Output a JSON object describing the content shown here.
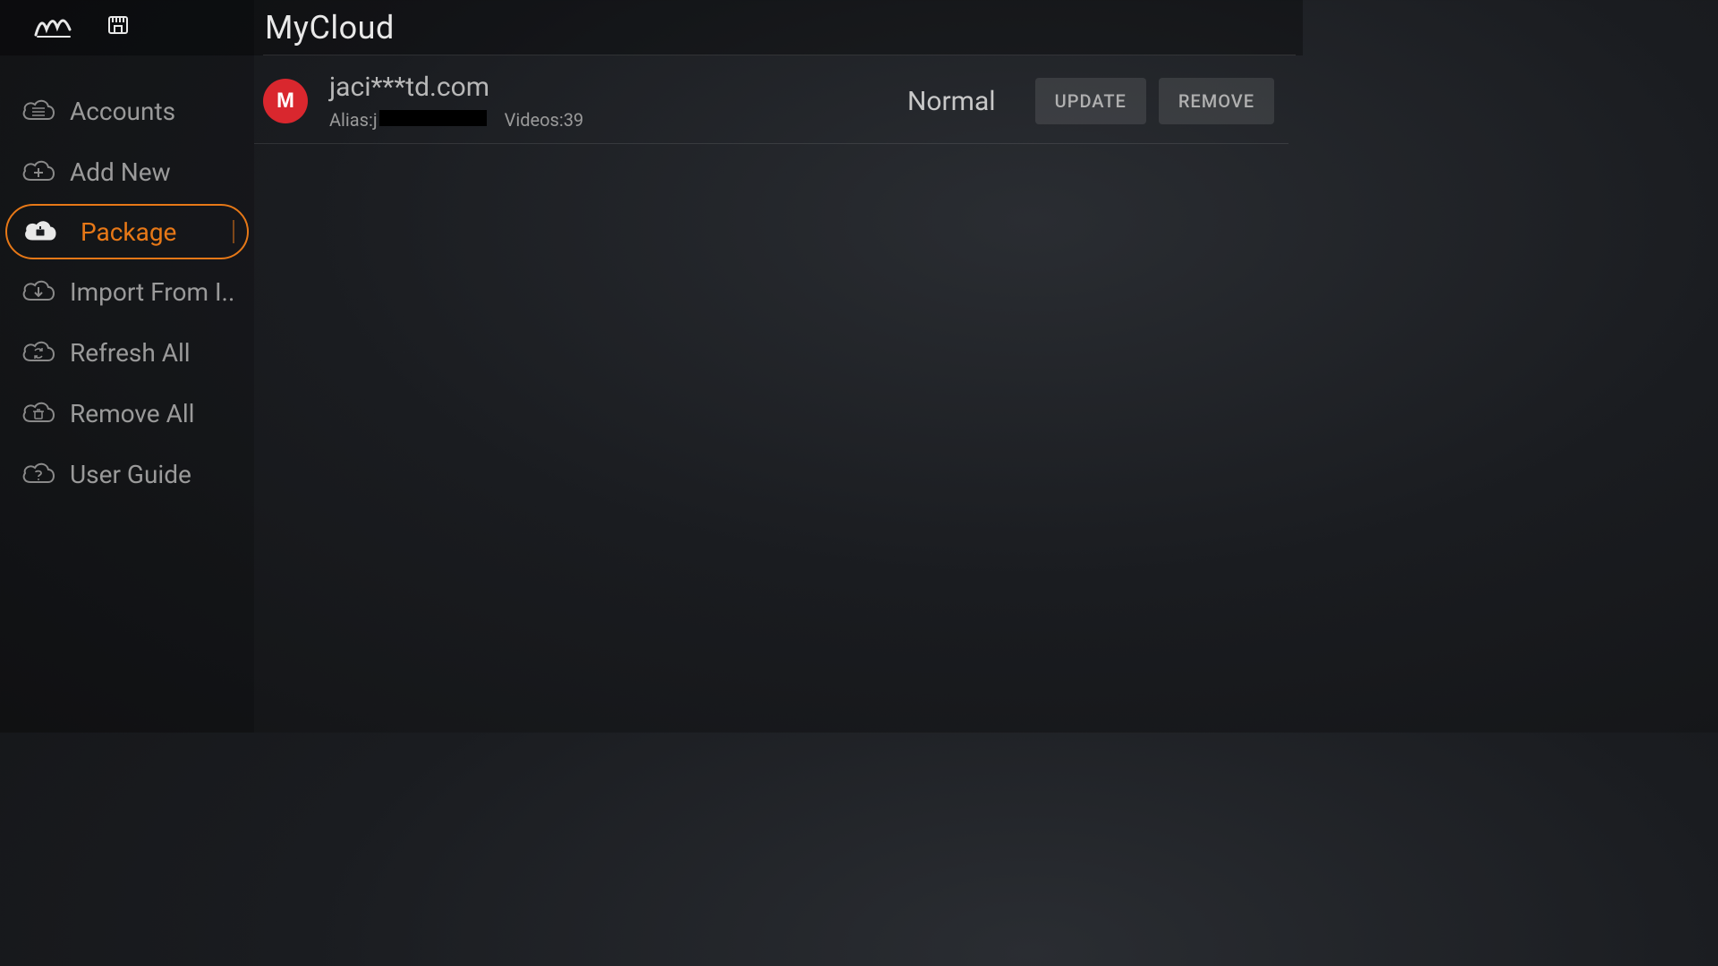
{
  "header": {
    "title": "MyCloud"
  },
  "sidebar": {
    "items": [
      {
        "id": "accounts",
        "label": "Accounts",
        "icon": "cloud-list-icon",
        "selected": false
      },
      {
        "id": "add-new",
        "label": "Add New",
        "icon": "cloud-plus-icon",
        "selected": false
      },
      {
        "id": "package",
        "label": "Package",
        "icon": "cloud-package-icon",
        "selected": true
      },
      {
        "id": "import",
        "label": "Import From I..",
        "icon": "cloud-download-icon",
        "selected": false
      },
      {
        "id": "refresh-all",
        "label": "Refresh All",
        "icon": "cloud-refresh-icon",
        "selected": false
      },
      {
        "id": "remove-all",
        "label": "Remove All",
        "icon": "cloud-trash-icon",
        "selected": false
      },
      {
        "id": "user-guide",
        "label": "User Guide",
        "icon": "cloud-help-icon",
        "selected": false
      }
    ]
  },
  "accounts": [
    {
      "provider_letter": "M",
      "provider_color": "#d9272e",
      "email": "jaci***td.com",
      "alias_prefix": "Alias:",
      "alias_value": "j",
      "videos_label": "Videos:",
      "videos_count": "39",
      "status": "Normal",
      "update_label": "UPDATE",
      "remove_label": "REMOVE"
    }
  ],
  "colors": {
    "accent": "#e77817",
    "mega": "#d9272e"
  }
}
